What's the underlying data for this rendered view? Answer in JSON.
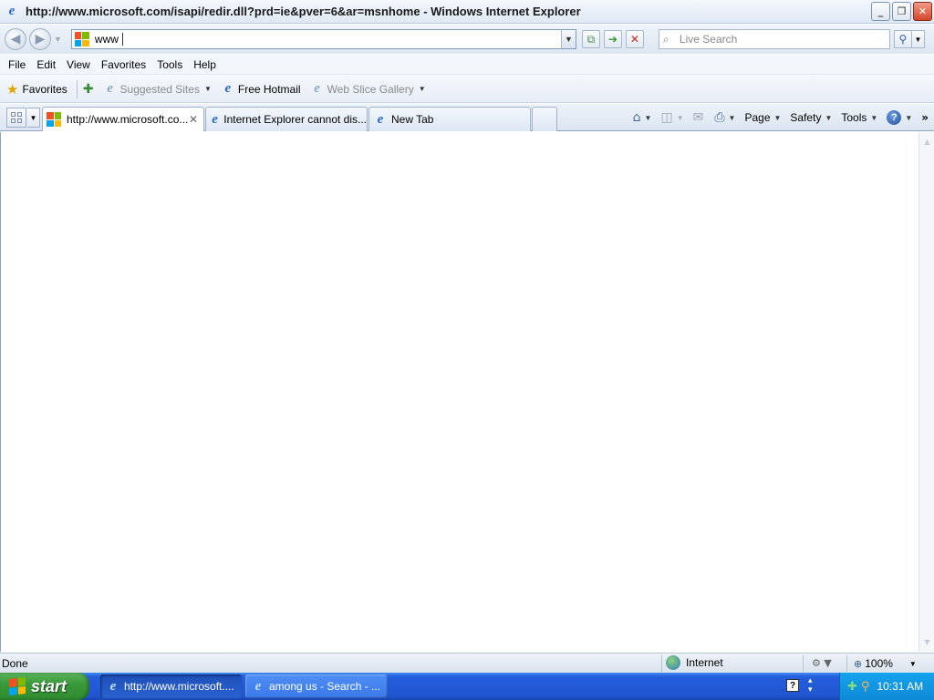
{
  "window": {
    "title": "http://www.microsoft.com/isapi/redir.dll?prd=ie&pver=6&ar=msnhome - Windows Internet Explorer",
    "minimize_glyph": "_",
    "restore_glyph": "❐",
    "close_glyph": "✕"
  },
  "address_bar": {
    "value": "www",
    "search_placeholder": "Live Search"
  },
  "menu": {
    "items": [
      "File",
      "Edit",
      "View",
      "Favorites",
      "Tools",
      "Help"
    ]
  },
  "favorites_bar": {
    "favorites_label": "Favorites",
    "links": [
      {
        "label": "Suggested Sites",
        "enabled": false,
        "has_dropdown": true
      },
      {
        "label": "Free Hotmail",
        "enabled": true,
        "has_dropdown": false
      },
      {
        "label": "Web Slice Gallery",
        "enabled": false,
        "has_dropdown": true
      }
    ]
  },
  "tabs": [
    {
      "label": "http://www.microsoft.co...",
      "icon": "windows-logo-icon",
      "active": true
    },
    {
      "label": "Internet Explorer cannot dis...",
      "icon": "ie-icon",
      "active": false
    },
    {
      "label": "New Tab",
      "icon": "ie-icon",
      "active": false
    }
  ],
  "command_bar": {
    "page_label": "Page",
    "safety_label": "Safety",
    "tools_label": "Tools"
  },
  "status_bar": {
    "status": "Done",
    "zone": "Internet",
    "zoom": "100%"
  },
  "taskbar": {
    "start_label": "start",
    "buttons": [
      {
        "label": "http://www.microsoft....",
        "active": true
      },
      {
        "label": "among us - Search - ...",
        "active": false
      }
    ],
    "clock": "10:31 AM"
  },
  "colors": {
    "windows_logo": [
      "#f25022",
      "#7fba00",
      "#00a4ef",
      "#ffb900"
    ],
    "taskbar_blue": "#245edc",
    "start_green": "#3a9a3a"
  }
}
